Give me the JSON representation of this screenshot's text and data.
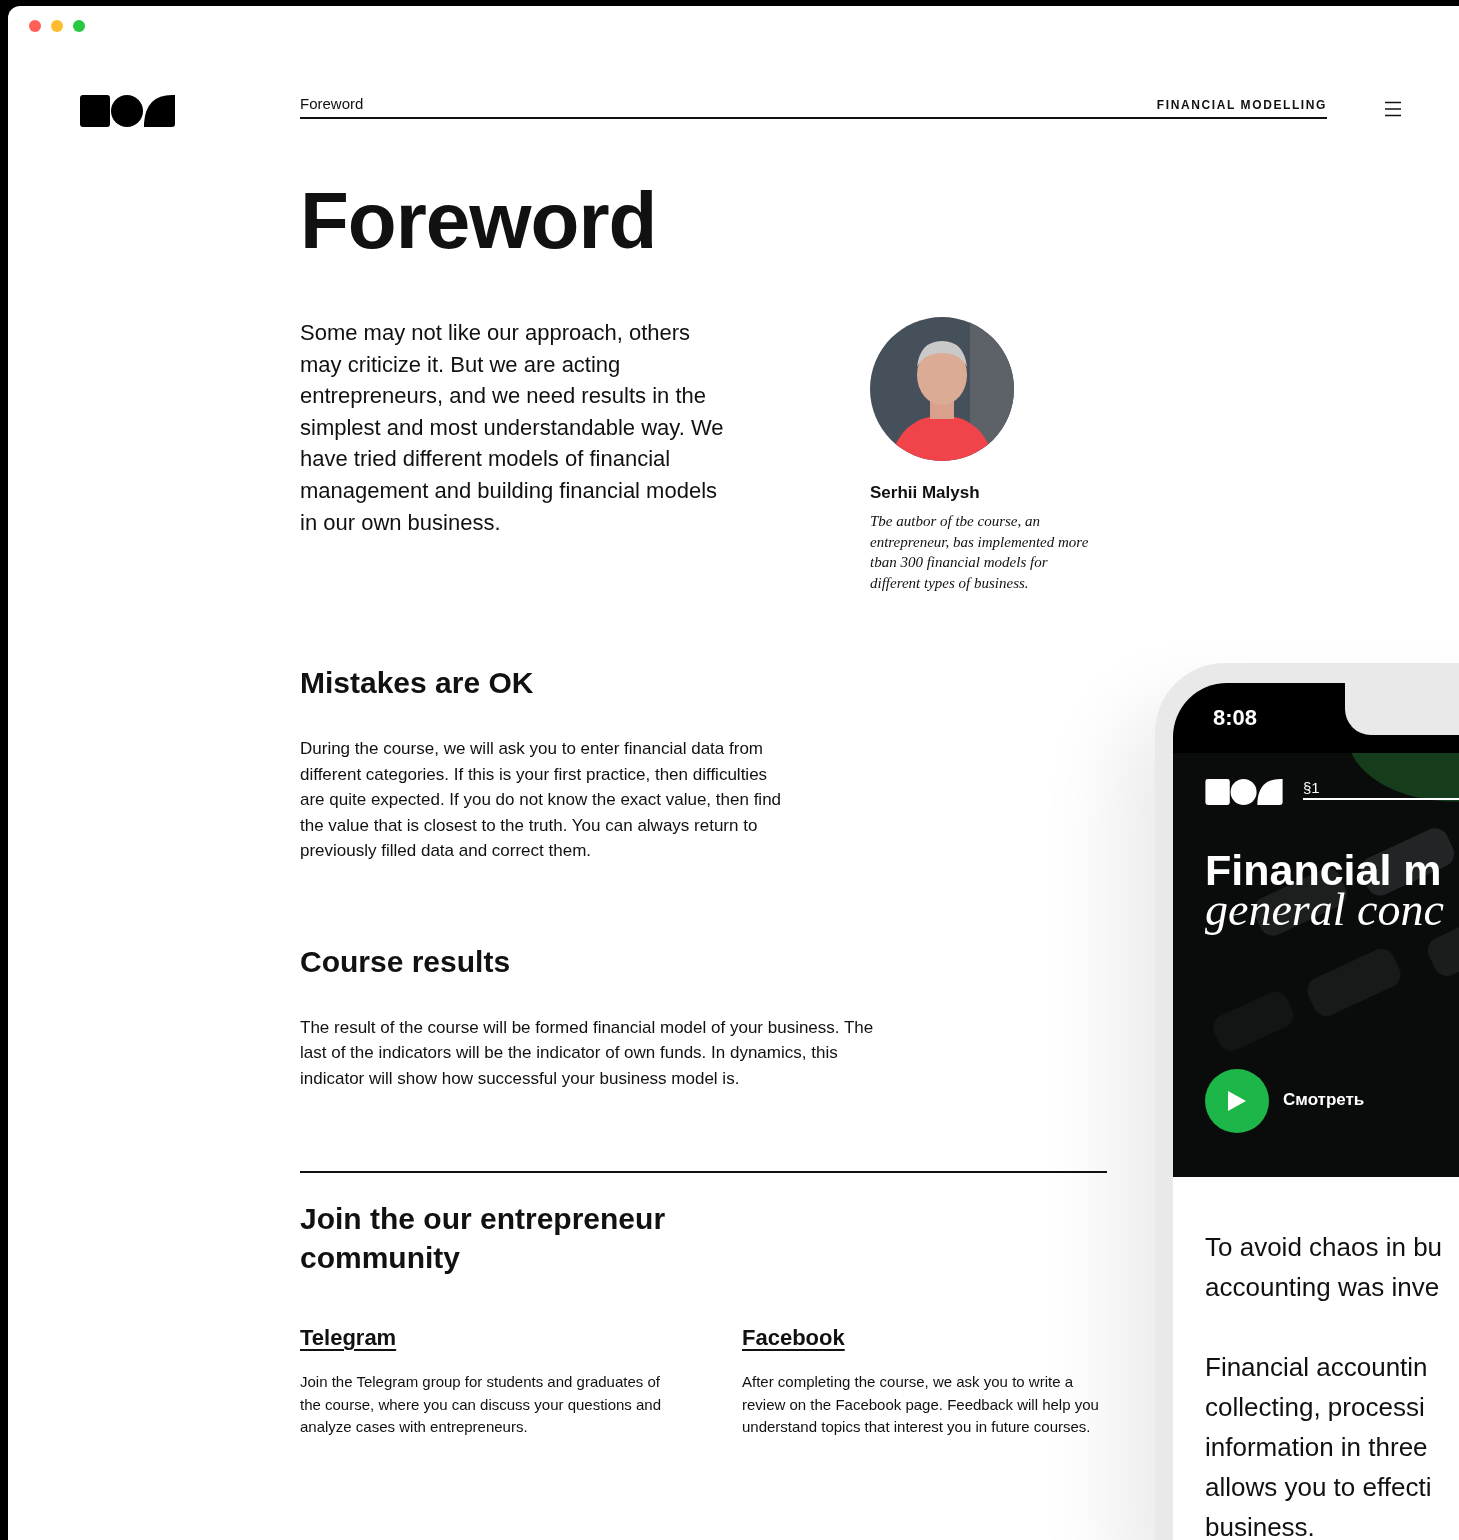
{
  "window_controls": [
    {
      "color": "#ff5f57"
    },
    {
      "color": "#febc2e"
    },
    {
      "color": "#28c840"
    }
  ],
  "header": {
    "breadcrumb": "Foreword",
    "section": "FINANCIAL MODELLING"
  },
  "title": "Foreword",
  "intro": "Some may not like our approach, others may criticize it. But we are acting entrepreneurs, and we need results in the simplest and most understandable way. We have tried different models of financial management and building financial models in our own business.",
  "author": {
    "kind": "picture",
    "name": "Serhii Malysh",
    "caption": "Tbe autbor of tbe course, an entrepreneur, bas implemented more tban 300 financial models for different types of business."
  },
  "sections": [
    {
      "heading": "Mistakes are OK",
      "body": "During the course, we will ask you to enter financial data from different categories. If this is your first practice, then difficulties are quite expected. If you do not know the exact value, then find the value that is closest to the truth. You can always return to previously filled data and correct them."
    },
    {
      "heading": "Course results",
      "body": "The result of the course will be formed financial model of your business. The last of the indicators will be the indicator of own funds. In dynamics, this indicator will show how successful your business model is."
    }
  ],
  "community": {
    "heading": "Join the our entrepreneur community",
    "links": [
      {
        "title": "Telegram",
        "body": "Join the Telegram group for students and graduates of the course, where you can discuss your questions and analyze cases with entrepreneurs."
      },
      {
        "title": "Facebook",
        "body": "After completing the course, we ask you to write a review on the Facebook page. Feedback will help you understand topics that interest you in future courses."
      }
    ]
  },
  "phone": {
    "time": "8:08",
    "section": "§1",
    "title": "Financial m",
    "subtitle": "general conc",
    "watch": "Смотреть",
    "paragraphs": [
      [
        "To avoid chaos in bu",
        "accounting was inve"
      ],
      [
        "Financial accountin",
        "collecting, processi",
        "information in three",
        "allows you to effecti",
        "business."
      ]
    ]
  }
}
